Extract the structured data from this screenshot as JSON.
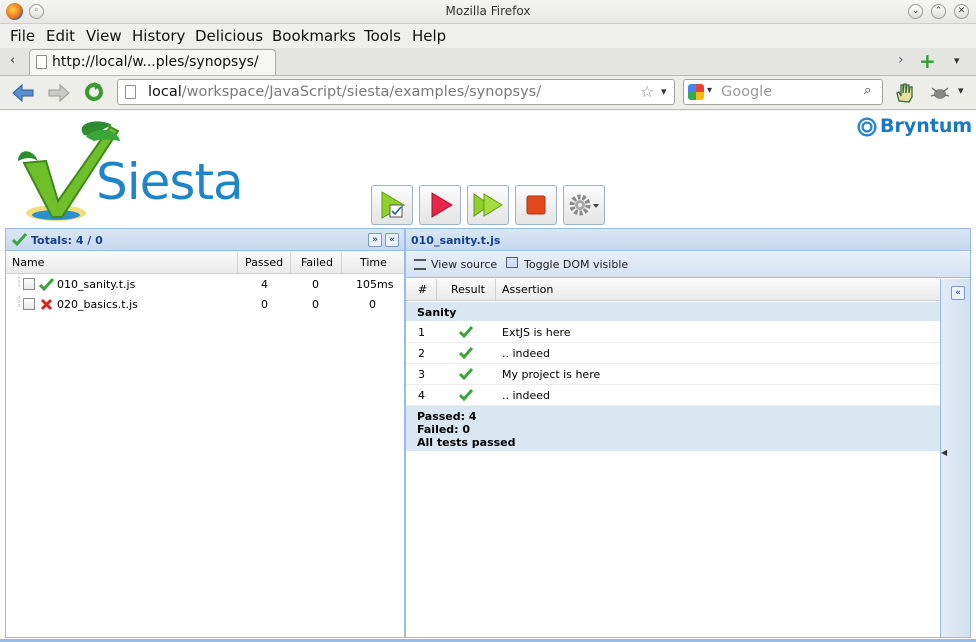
{
  "window": {
    "title": "Mozilla Firefox"
  },
  "menu": [
    "File",
    "Edit",
    "View",
    "History",
    "Delicious",
    "Bookmarks",
    "Tools",
    "Help"
  ],
  "tab": {
    "title": "http://local/w...ples/synopsys/"
  },
  "url": {
    "host": "local",
    "path": "/workspace/JavaScript/siesta/examples/synopsys/"
  },
  "search": {
    "placeholder": "Google"
  },
  "brand": {
    "logo_text": "Siesta",
    "partner": "Bryntum"
  },
  "left_panel": {
    "title": "Totals: 4 / 0",
    "columns": [
      "Name",
      "Passed",
      "Failed",
      "Time"
    ],
    "rows": [
      {
        "name": "010_sanity.t.js",
        "passed": "4",
        "failed": "0",
        "time": "105ms",
        "status": "pass"
      },
      {
        "name": "020_basics.t.js",
        "passed": "0",
        "failed": "0",
        "time": "0",
        "status": "fail"
      }
    ]
  },
  "right_panel": {
    "title": "010_sanity.t.js",
    "toolbar": {
      "view_source": "View source",
      "toggle_dom": "Toggle DOM visible"
    },
    "columns": [
      "#",
      "Result",
      "Assertion"
    ],
    "group": "Sanity",
    "assertions": [
      {
        "num": "1",
        "text": "ExtJS is here"
      },
      {
        "num": "2",
        "text": ".. indeed"
      },
      {
        "num": "3",
        "text": "My project is here"
      },
      {
        "num": "4",
        "text": ".. indeed"
      }
    ],
    "summary": {
      "passed": "Passed: 4",
      "failed": "Failed: 0",
      "all": "All tests passed"
    }
  },
  "colors": {
    "accent": "#15428b",
    "pass": "#3aa53a",
    "fail": "#d9261c",
    "border": "#99bbe8"
  }
}
